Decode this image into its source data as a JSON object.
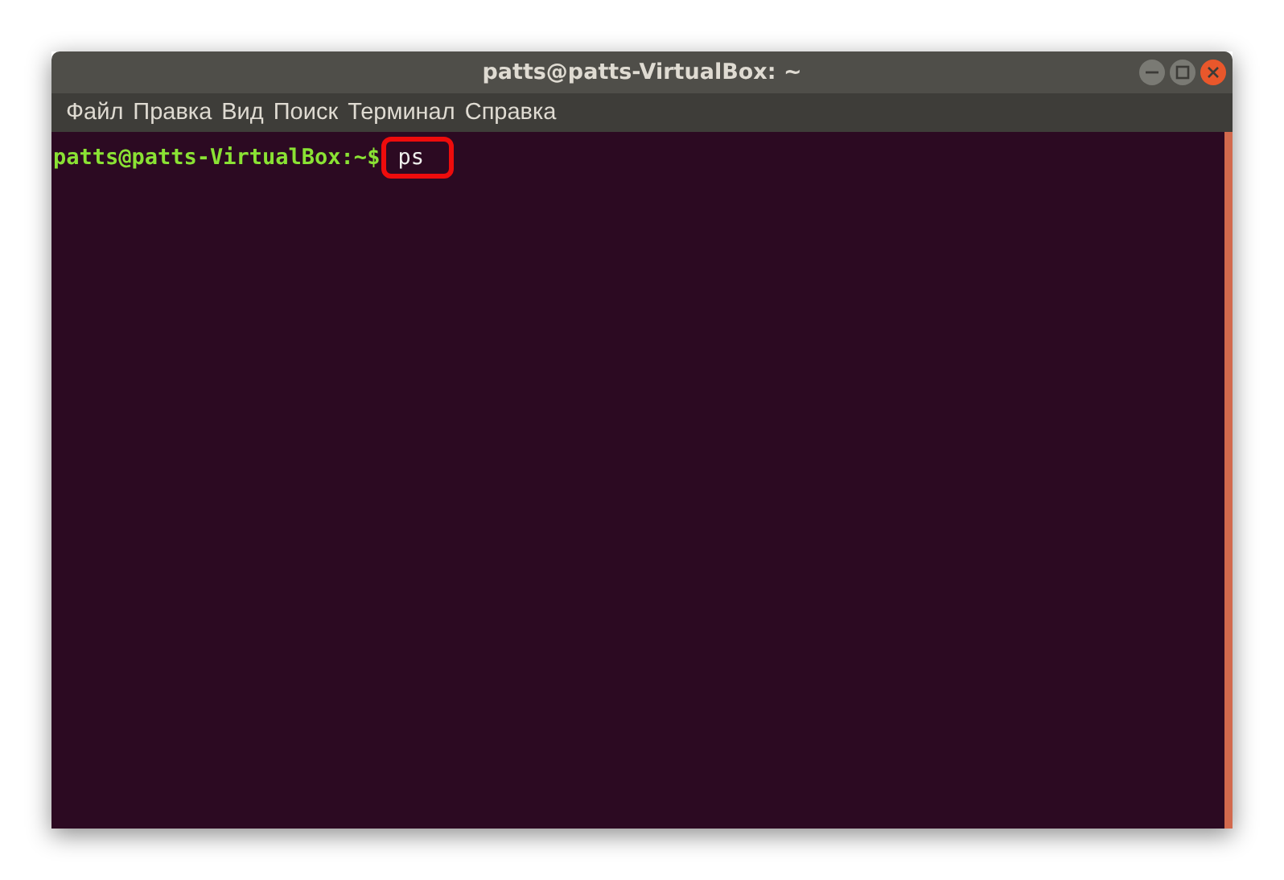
{
  "window": {
    "title": "patts@patts-VirtualBox: ~"
  },
  "menu": [
    "Файл",
    "Правка",
    "Вид",
    "Поиск",
    "Терминал",
    "Справка"
  ],
  "terminal": {
    "prompt": "patts@patts-VirtualBox:~$",
    "command": "ps",
    "command_highlighted": true
  }
}
